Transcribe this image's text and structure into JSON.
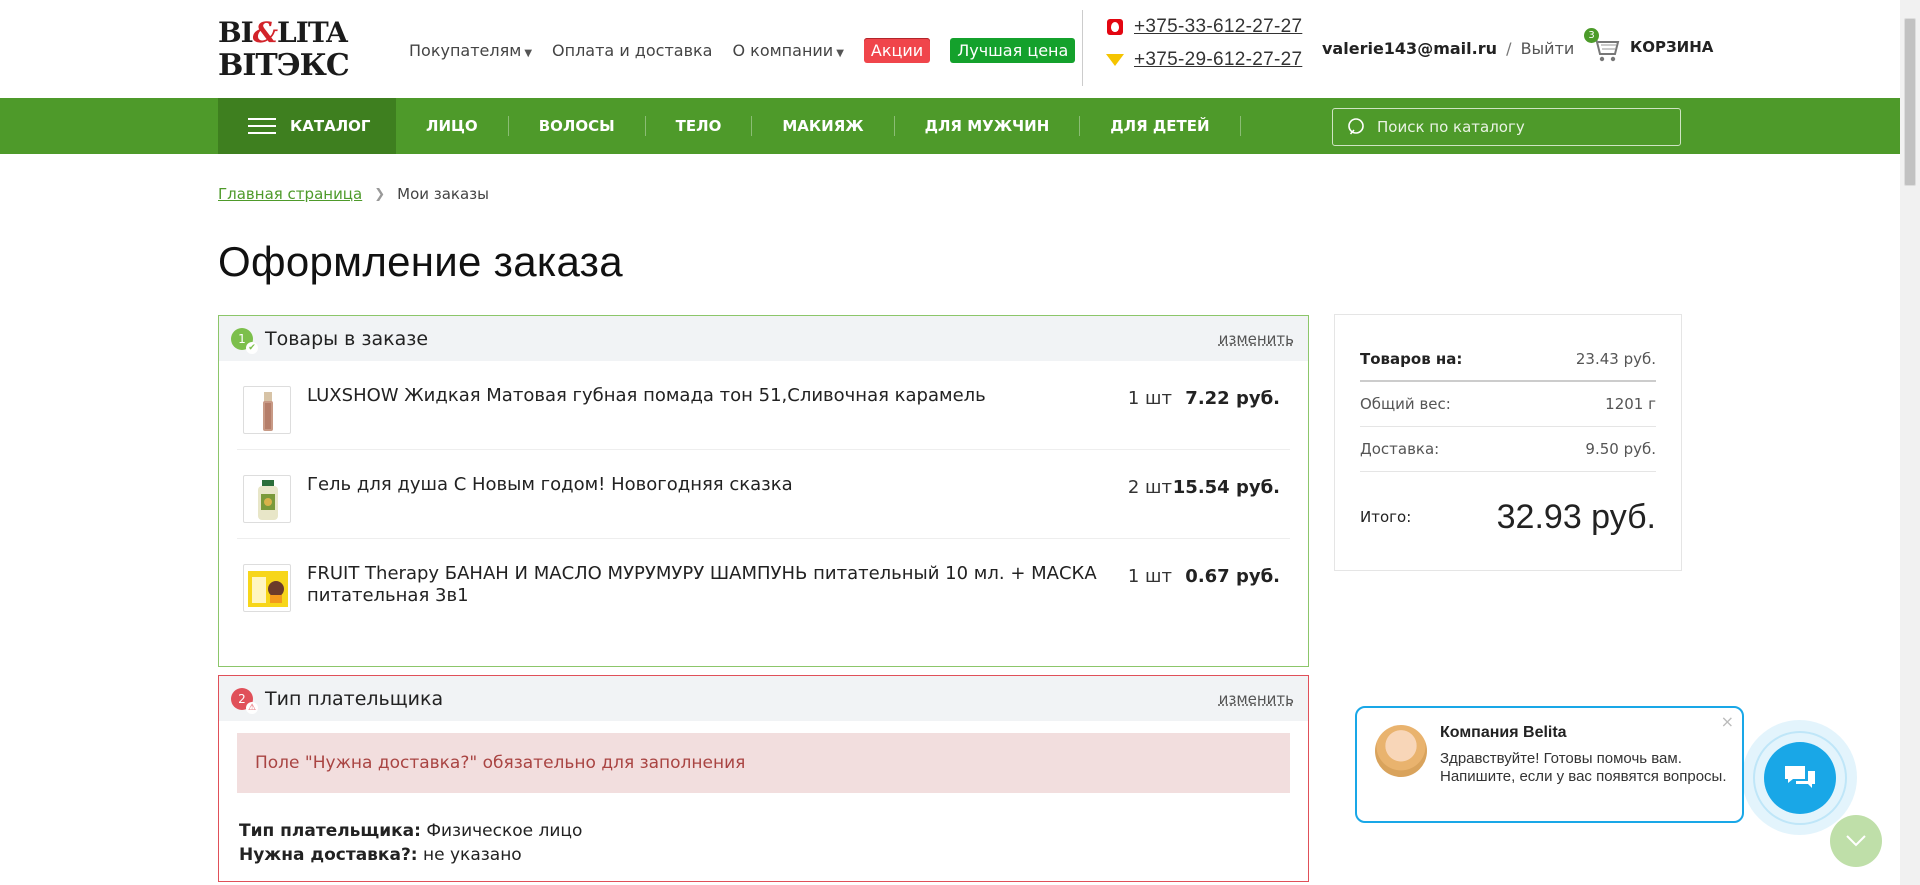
{
  "logo": {
    "line1": "BI",
    "amp": "&",
    "line1b": "LITA",
    "line2": "ВIТЭКС"
  },
  "topnav": {
    "buyers": "Покупателям",
    "payment": "Оплата и доставка",
    "about": "О компании",
    "sale": "Акции",
    "best_price": "Лучшая цена"
  },
  "phones": [
    "+375-33-612-27-27",
    "+375-29-612-27-27"
  ],
  "user": {
    "email": "valerie143@mail.ru",
    "separator": "/",
    "logout": "Выйти"
  },
  "cart": {
    "count": "3",
    "label": "КОРЗИНА"
  },
  "greennav": {
    "catalog": "КАТАЛОГ",
    "items": [
      "ЛИЦО",
      "ВОЛОСЫ",
      "ТЕЛО",
      "МАКИЯЖ",
      "ДЛЯ МУЖЧИН",
      "ДЛЯ ДЕТЕЙ"
    ],
    "search_placeholder": "Поиск по каталогу"
  },
  "breadcrumb": {
    "home": "Главная страница",
    "current": "Мои заказы"
  },
  "page_title": "Оформление заказа",
  "goods_block": {
    "step": "1",
    "title": "Товары в заказе",
    "change": "изменить",
    "items": [
      {
        "name": "LUXSHOW Жидкая Матовая губная помада тон 51,Сливочная карамель",
        "qty": "1 шт",
        "price": "7.22 руб."
      },
      {
        "name": "Гель для душа С Новым годом! Новогодняя сказка",
        "qty": "2 шт",
        "price": "15.54 руб."
      },
      {
        "name": "FRUIT Therapy БАНАН И МАСЛО МУРУМУРУ ШАМПУНЬ питательный 10 мл. + МАСКА питательная 3в1",
        "qty": "1 шт",
        "price": "0.67 руб."
      }
    ]
  },
  "payer_block": {
    "step": "2",
    "title": "Тип плательщика",
    "change": "изменить",
    "error": "Поле \"Нужна доставка?\" обязательно для заполнения",
    "payer_label": "Тип плательщика:",
    "payer_value": "Физическое лицо",
    "delivery_label": "Нужна доставка?:",
    "delivery_value": "не указано"
  },
  "summary": {
    "goods_label": "Товаров на:",
    "goods_value": "23.43 руб.",
    "weight_label": "Общий вес:",
    "weight_value": "1201 г",
    "delivery_label": "Доставка:",
    "delivery_value": "9.50 руб.",
    "total_label": "Итого:",
    "total_value": "32.93 руб."
  },
  "chat": {
    "name": "Компания Belita",
    "message": "Здравствуйте! Готовы помочь вам. Напишите, если у вас появятся вопросы.",
    "close": "×"
  },
  "colors": {
    "green": "#4e9a2a",
    "dark_green": "#3e7f1f",
    "error_red": "#e05059",
    "chat_blue": "#19a7e7"
  }
}
